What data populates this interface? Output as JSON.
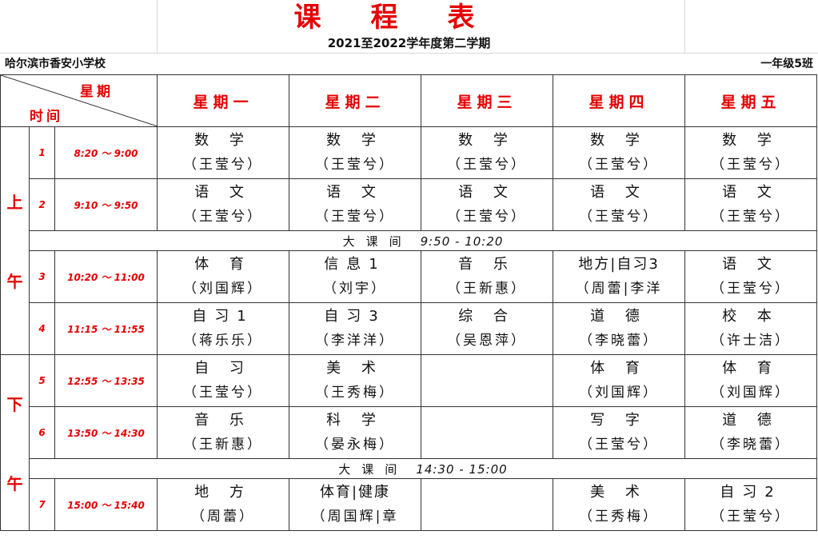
{
  "title": "课程表",
  "subtitle": "2021至2022学年度第二学期",
  "school": "哈尔滨市香安小学校",
  "class_name": "一年级5班",
  "corner": {
    "top": "星期",
    "bottom": "时间"
  },
  "days": [
    "星期一",
    "星期二",
    "星期三",
    "星期四",
    "星期五"
  ],
  "halves": {
    "morning": [
      "上",
      "午"
    ],
    "afternoon": [
      "下",
      "午"
    ]
  },
  "periods": [
    {
      "num": "1",
      "time": "8:20 ～ 9:00",
      "cells": [
        {
          "subject": "数 学",
          "teacher": "（王莹兮）"
        },
        {
          "subject": "数 学",
          "teacher": "（王莹兮）"
        },
        {
          "subject": "数 学",
          "teacher": "（王莹兮）"
        },
        {
          "subject": "数 学",
          "teacher": "（王莹兮）"
        },
        {
          "subject": "数 学",
          "teacher": "（王莹兮）"
        }
      ]
    },
    {
      "num": "2",
      "time": "9:10 ～ 9:50",
      "cells": [
        {
          "subject": "语 文",
          "teacher": "（王莹兮）"
        },
        {
          "subject": "语 文",
          "teacher": "（王莹兮）"
        },
        {
          "subject": "语 文",
          "teacher": "（王莹兮）"
        },
        {
          "subject": "语 文",
          "teacher": "（王莹兮）"
        },
        {
          "subject": "语 文",
          "teacher": "（王莹兮）"
        }
      ]
    },
    {
      "num": "3",
      "time": "10:20 ～ 11:00",
      "cells": [
        {
          "subject": "体 育",
          "teacher": "（刘国辉）"
        },
        {
          "subject": "信息1",
          "teacher": "（刘宇）"
        },
        {
          "subject": "音 乐",
          "teacher": "（王新惠）"
        },
        {
          "subject": "地方|自习3",
          "teacher": "（周蕾|李洋"
        },
        {
          "subject": "语 文",
          "teacher": "（王莹兮）"
        }
      ]
    },
    {
      "num": "4",
      "time": "11:15 ～ 11:55",
      "cells": [
        {
          "subject": "自习1",
          "teacher": "（蒋乐乐）"
        },
        {
          "subject": "自习3",
          "teacher": "（李洋洋）"
        },
        {
          "subject": "综 合",
          "teacher": "（吴恩萍）"
        },
        {
          "subject": "道 德",
          "teacher": "（李晓蕾）"
        },
        {
          "subject": "校 本",
          "teacher": "（许士洁）"
        }
      ]
    },
    {
      "num": "5",
      "time": "12:55 ～ 13:35",
      "cells": [
        {
          "subject": "自 习",
          "teacher": "（王莹兮）"
        },
        {
          "subject": "美 术",
          "teacher": "（王秀梅）"
        },
        {
          "subject": "",
          "teacher": ""
        },
        {
          "subject": "体 育",
          "teacher": "（刘国辉）"
        },
        {
          "subject": "体 育",
          "teacher": "（刘国辉）"
        }
      ]
    },
    {
      "num": "6",
      "time": "13:50 ～ 14:30",
      "cells": [
        {
          "subject": "音 乐",
          "teacher": "（王新惠）"
        },
        {
          "subject": "科 学",
          "teacher": "（晏永梅）"
        },
        {
          "subject": "",
          "teacher": ""
        },
        {
          "subject": "写 字",
          "teacher": "（王莹兮）"
        },
        {
          "subject": "道 德",
          "teacher": "（李晓蕾）"
        }
      ]
    },
    {
      "num": "7",
      "time": "15:00 ～ 15:40",
      "cells": [
        {
          "subject": "地 方",
          "teacher": "（周蕾）"
        },
        {
          "subject": "体育|健康",
          "teacher": "（周国辉|章"
        },
        {
          "subject": "",
          "teacher": ""
        },
        {
          "subject": "美 术",
          "teacher": "（王秀梅）"
        },
        {
          "subject": "自习2",
          "teacher": "（王莹兮）"
        }
      ]
    }
  ],
  "breaks": [
    {
      "label": "大课间",
      "time": "9:50 - 10:20"
    },
    {
      "label": "大课间",
      "time": "14:30 - 15:00"
    }
  ]
}
